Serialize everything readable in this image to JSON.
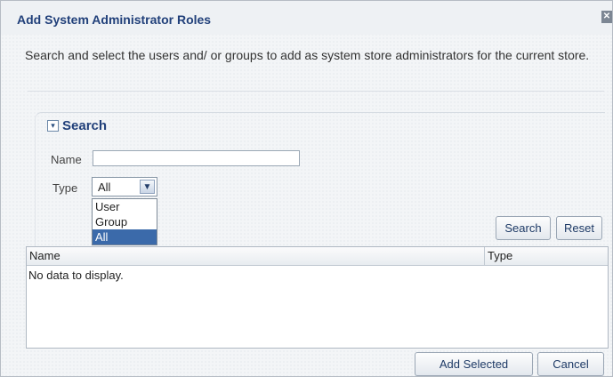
{
  "dialog": {
    "title": "Add System Administrator Roles",
    "close_icon": "close-icon",
    "description": "Search and select the users and/ or groups to add as system store administrators for the current store."
  },
  "search": {
    "header": "Search",
    "disclosure_icon": "chevron-down-icon",
    "name_label": "Name",
    "name_value": "",
    "type_label": "Type",
    "type_value": "All",
    "type_options": [
      "User",
      "Group",
      "All"
    ],
    "selected_option": "All",
    "search_button": "Search",
    "reset_button": "Reset"
  },
  "results": {
    "columns": [
      "Name",
      "Type"
    ],
    "empty_message": "No data to display."
  },
  "footer": {
    "add_selected_button": "Add Selected",
    "cancel_button": "Cancel"
  },
  "colors": {
    "title_text": "#21407a",
    "selected_option_bg": "#3b6aaa"
  }
}
